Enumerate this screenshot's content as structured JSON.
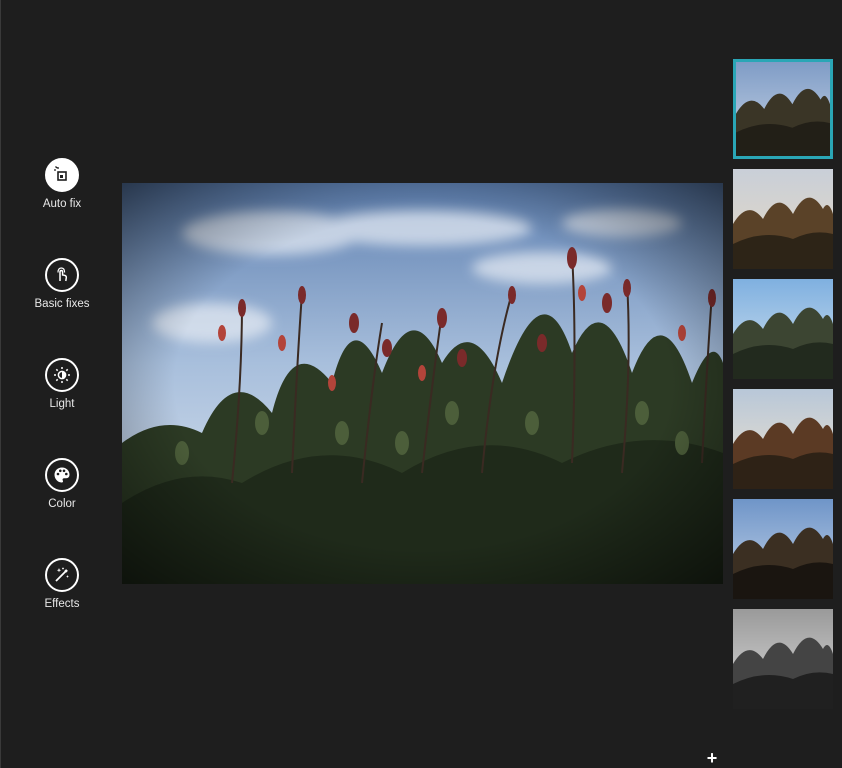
{
  "tools": [
    {
      "label": "Auto fix",
      "icon": "auto-fix-icon",
      "active": true
    },
    {
      "label": "Basic fixes",
      "icon": "touch-icon",
      "active": false
    },
    {
      "label": "Light",
      "icon": "brightness-icon",
      "active": false
    },
    {
      "label": "Color",
      "icon": "palette-icon",
      "active": false
    },
    {
      "label": "Effects",
      "icon": "magic-wand-icon",
      "active": false
    }
  ],
  "photo": {
    "subject": "red-green shrub leaves against blue sky"
  },
  "thumbnails": [
    {
      "variant": "original",
      "selected": true
    },
    {
      "variant": "warm",
      "selected": false
    },
    {
      "variant": "cool",
      "selected": false
    },
    {
      "variant": "vivid",
      "selected": false
    },
    {
      "variant": "contrast",
      "selected": false
    },
    {
      "variant": "black-and-white",
      "selected": false
    }
  ],
  "add_label": "+",
  "colors": {
    "background": "#1e1e1e",
    "selection": "#2aa6b6",
    "icon": "#ffffff"
  }
}
